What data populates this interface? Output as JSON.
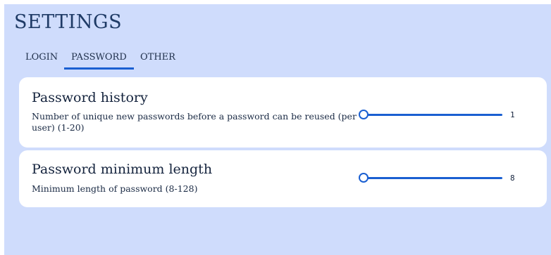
{
  "page": {
    "title": "SETTINGS"
  },
  "tabs": [
    {
      "label": "LOGIN",
      "active": false
    },
    {
      "label": "PASSWORD",
      "active": true
    },
    {
      "label": "OTHER",
      "active": false
    }
  ],
  "settings": [
    {
      "title": "Password history",
      "description": "Number of unique new passwords before a password can be reused (per user) (1-20)",
      "min": 1,
      "max": 20,
      "value": "1"
    },
    {
      "title": "Password minimum length",
      "description": "Minimum length of password (8-128)",
      "min": 8,
      "max": 128,
      "value": "8"
    }
  ],
  "colors": {
    "background": "#cfdcfc",
    "card": "#ffffff",
    "accent": "#1a5fd1",
    "title": "#1f3b66"
  }
}
